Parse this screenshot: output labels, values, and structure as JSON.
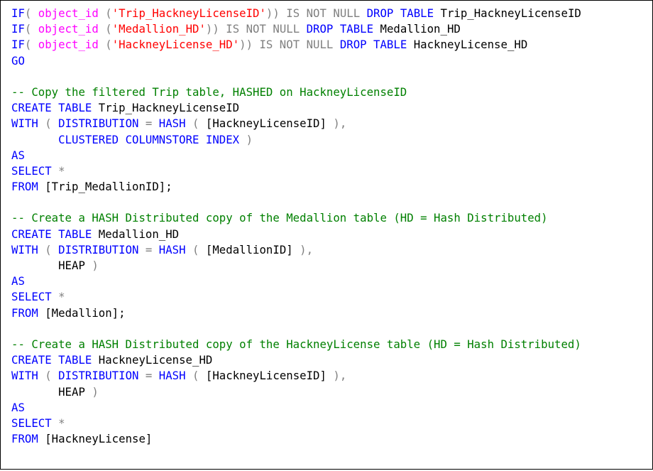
{
  "editor": {
    "colors": {
      "kw": "#0000ff",
      "fn": "#ff00ff",
      "str": "#ff0000",
      "op": "#808080",
      "cm": "#008000",
      "id": "#000000"
    },
    "lines": [
      [
        [
          "kw",
          "IF"
        ],
        [
          "op",
          "( "
        ],
        [
          "fn",
          "object_id"
        ],
        [
          "op",
          " ("
        ],
        [
          "str",
          "'Trip_HackneyLicenseID'"
        ],
        [
          "op",
          "))"
        ],
        [
          "op",
          " IS NOT NULL "
        ],
        [
          "kw",
          "DROP TABLE "
        ],
        [
          "id",
          "Trip_HackneyLicenseID"
        ]
      ],
      [
        [
          "kw",
          "IF"
        ],
        [
          "op",
          "( "
        ],
        [
          "fn",
          "object_id"
        ],
        [
          "op",
          " ("
        ],
        [
          "str",
          "'Medallion_HD'"
        ],
        [
          "op",
          "))"
        ],
        [
          "op",
          " IS NOT NULL "
        ],
        [
          "kw",
          "DROP TABLE "
        ],
        [
          "id",
          "Medallion_HD"
        ]
      ],
      [
        [
          "kw",
          "IF"
        ],
        [
          "op",
          "( "
        ],
        [
          "fn",
          "object_id"
        ],
        [
          "op",
          " ("
        ],
        [
          "str",
          "'HackneyLicense_HD'"
        ],
        [
          "op",
          "))"
        ],
        [
          "op",
          " IS NOT NULL "
        ],
        [
          "kw",
          "DROP TABLE "
        ],
        [
          "id",
          "HackneyLicense_HD"
        ]
      ],
      [
        [
          "kw",
          "GO"
        ]
      ],
      [],
      [
        [
          "cm",
          "-- Copy the filtered Trip table, HASHED on HackneyLicenseID"
        ]
      ],
      [
        [
          "kw",
          "CREATE TABLE "
        ],
        [
          "id",
          "Trip_HackneyLicenseID"
        ]
      ],
      [
        [
          "kw",
          "WITH "
        ],
        [
          "op",
          "( "
        ],
        [
          "kw",
          "DISTRIBUTION "
        ],
        [
          "op",
          "= "
        ],
        [
          "kw",
          "HASH "
        ],
        [
          "op",
          "( "
        ],
        [
          "id",
          "[HackneyLicenseID] "
        ],
        [
          "op",
          "),"
        ]
      ],
      [
        [
          "id",
          "       "
        ],
        [
          "kw",
          "CLUSTERED COLUMNSTORE INDEX "
        ],
        [
          "op",
          ")"
        ]
      ],
      [
        [
          "kw",
          "AS"
        ]
      ],
      [
        [
          "kw",
          "SELECT "
        ],
        [
          "op",
          "*"
        ]
      ],
      [
        [
          "kw",
          "FROM "
        ],
        [
          "id",
          "[Trip_MedallionID];"
        ]
      ],
      [],
      [
        [
          "cm",
          "-- Create a HASH Distributed copy of the Medallion table (HD = Hash Distributed)"
        ]
      ],
      [
        [
          "kw",
          "CREATE TABLE "
        ],
        [
          "id",
          "Medallion_HD"
        ]
      ],
      [
        [
          "kw",
          "WITH "
        ],
        [
          "op",
          "( "
        ],
        [
          "kw",
          "DISTRIBUTION "
        ],
        [
          "op",
          "= "
        ],
        [
          "kw",
          "HASH "
        ],
        [
          "op",
          "( "
        ],
        [
          "id",
          "[MedallionID] "
        ],
        [
          "op",
          "),"
        ]
      ],
      [
        [
          "id",
          "       HEAP "
        ],
        [
          "op",
          ")"
        ]
      ],
      [
        [
          "kw",
          "AS"
        ]
      ],
      [
        [
          "kw",
          "SELECT "
        ],
        [
          "op",
          "*"
        ]
      ],
      [
        [
          "kw",
          "FROM "
        ],
        [
          "id",
          "[Medallion];"
        ]
      ],
      [],
      [
        [
          "cm",
          "-- Create a HASH Distributed copy of the HackneyLicense table (HD = Hash Distributed)"
        ]
      ],
      [
        [
          "kw",
          "CREATE TABLE "
        ],
        [
          "id",
          "HackneyLicense_HD"
        ]
      ],
      [
        [
          "kw",
          "WITH "
        ],
        [
          "op",
          "( "
        ],
        [
          "kw",
          "DISTRIBUTION "
        ],
        [
          "op",
          "= "
        ],
        [
          "kw",
          "HASH "
        ],
        [
          "op",
          "( "
        ],
        [
          "id",
          "[HackneyLicenseID] "
        ],
        [
          "op",
          "),"
        ]
      ],
      [
        [
          "id",
          "       HEAP "
        ],
        [
          "op",
          ")"
        ]
      ],
      [
        [
          "kw",
          "AS"
        ]
      ],
      [
        [
          "kw",
          "SELECT "
        ],
        [
          "op",
          "*"
        ]
      ],
      [
        [
          "kw",
          "FROM "
        ],
        [
          "id",
          "[HackneyLicense]"
        ]
      ]
    ]
  }
}
